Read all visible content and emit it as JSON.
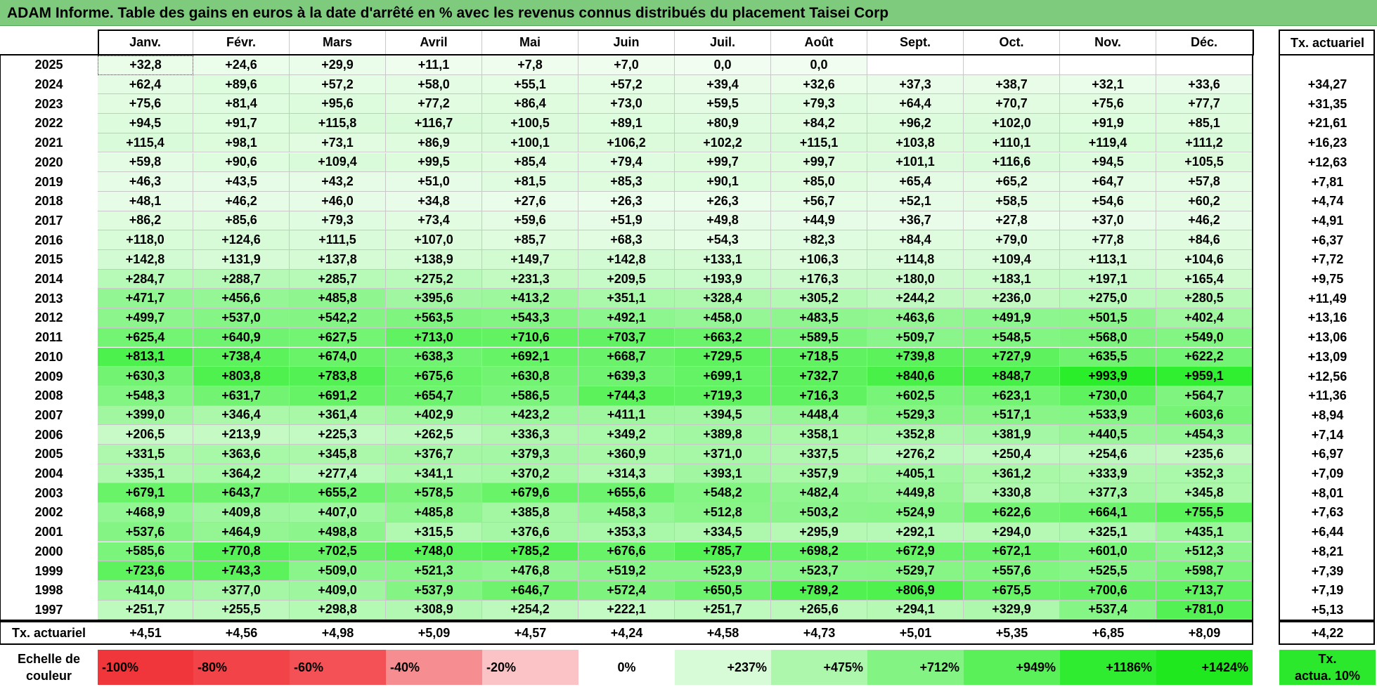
{
  "title": "ADAM Informe. Table des gains en euros à la date d'arrêté en % avec les revenus connus distribués du placement Taisei Corp",
  "months": [
    "Janv.",
    "Févr.",
    "Mars",
    "Avril",
    "Mai",
    "Juin",
    "Juil.",
    "Août",
    "Sept.",
    "Oct.",
    "Nov.",
    "Déc."
  ],
  "rate_header": "Tx. actuariel",
  "rows": [
    {
      "year": "2025",
      "values": [
        "+32,8",
        "+24,6",
        "+29,9",
        "+11,1",
        "+7,8",
        "+7,0",
        "0,0",
        "0,0",
        "",
        "",
        "",
        ""
      ],
      "rate": ""
    },
    {
      "year": "2024",
      "values": [
        "+62,4",
        "+89,6",
        "+57,2",
        "+58,0",
        "+55,1",
        "+57,2",
        "+39,4",
        "+32,6",
        "+37,3",
        "+38,7",
        "+32,1",
        "+33,6"
      ],
      "rate": "+34,27"
    },
    {
      "year": "2023",
      "values": [
        "+75,6",
        "+81,4",
        "+95,6",
        "+77,2",
        "+86,4",
        "+73,0",
        "+59,5",
        "+79,3",
        "+64,4",
        "+70,7",
        "+75,6",
        "+77,7"
      ],
      "rate": "+31,35"
    },
    {
      "year": "2022",
      "values": [
        "+94,5",
        "+91,7",
        "+115,8",
        "+116,7",
        "+100,5",
        "+89,1",
        "+80,9",
        "+84,2",
        "+96,2",
        "+102,0",
        "+91,9",
        "+85,1"
      ],
      "rate": "+21,61"
    },
    {
      "year": "2021",
      "values": [
        "+115,4",
        "+98,1",
        "+73,1",
        "+86,9",
        "+100,1",
        "+106,2",
        "+102,2",
        "+115,1",
        "+103,8",
        "+110,1",
        "+119,4",
        "+111,2"
      ],
      "rate": "+16,23"
    },
    {
      "year": "2020",
      "values": [
        "+59,8",
        "+90,6",
        "+109,4",
        "+99,5",
        "+85,4",
        "+79,4",
        "+99,7",
        "+99,7",
        "+101,1",
        "+116,6",
        "+94,5",
        "+105,5"
      ],
      "rate": "+12,63"
    },
    {
      "year": "2019",
      "values": [
        "+46,3",
        "+43,5",
        "+43,2",
        "+51,0",
        "+81,5",
        "+85,3",
        "+90,1",
        "+85,0",
        "+65,4",
        "+65,2",
        "+64,7",
        "+57,8"
      ],
      "rate": "+7,81"
    },
    {
      "year": "2018",
      "values": [
        "+48,1",
        "+46,2",
        "+46,0",
        "+34,8",
        "+27,6",
        "+26,3",
        "+26,3",
        "+56,7",
        "+52,1",
        "+58,5",
        "+54,6",
        "+60,2"
      ],
      "rate": "+4,74"
    },
    {
      "year": "2017",
      "values": [
        "+86,2",
        "+85,6",
        "+79,3",
        "+73,4",
        "+59,6",
        "+51,9",
        "+49,8",
        "+44,9",
        "+36,7",
        "+27,8",
        "+37,0",
        "+46,2"
      ],
      "rate": "+4,91"
    },
    {
      "year": "2016",
      "values": [
        "+118,0",
        "+124,6",
        "+111,5",
        "+107,0",
        "+85,7",
        "+68,3",
        "+54,3",
        "+82,3",
        "+84,4",
        "+79,0",
        "+77,8",
        "+84,6"
      ],
      "rate": "+6,37"
    },
    {
      "year": "2015",
      "values": [
        "+142,8",
        "+131,9",
        "+137,8",
        "+138,9",
        "+149,7",
        "+142,8",
        "+133,1",
        "+106,3",
        "+114,8",
        "+109,4",
        "+113,1",
        "+104,6"
      ],
      "rate": "+7,72"
    },
    {
      "year": "2014",
      "values": [
        "+284,7",
        "+288,7",
        "+285,7",
        "+275,2",
        "+231,3",
        "+209,5",
        "+193,9",
        "+176,3",
        "+180,0",
        "+183,1",
        "+197,1",
        "+165,4"
      ],
      "rate": "+9,75"
    },
    {
      "year": "2013",
      "values": [
        "+471,7",
        "+456,6",
        "+485,8",
        "+395,6",
        "+413,2",
        "+351,1",
        "+328,4",
        "+305,2",
        "+244,2",
        "+236,0",
        "+275,0",
        "+280,5"
      ],
      "rate": "+11,49"
    },
    {
      "year": "2012",
      "values": [
        "+499,7",
        "+537,0",
        "+542,2",
        "+563,5",
        "+543,3",
        "+492,1",
        "+458,0",
        "+483,5",
        "+463,6",
        "+491,9",
        "+501,5",
        "+402,4"
      ],
      "rate": "+13,16"
    },
    {
      "year": "2011",
      "values": [
        "+625,4",
        "+640,9",
        "+627,5",
        "+713,0",
        "+710,6",
        "+703,7",
        "+663,2",
        "+589,5",
        "+509,7",
        "+548,5",
        "+568,0",
        "+549,0"
      ],
      "rate": "+13,06"
    },
    {
      "year": "2010",
      "values": [
        "+813,1",
        "+738,4",
        "+674,0",
        "+638,3",
        "+692,1",
        "+668,7",
        "+729,5",
        "+718,5",
        "+739,8",
        "+727,9",
        "+635,5",
        "+622,2"
      ],
      "rate": "+13,09"
    },
    {
      "year": "2009",
      "values": [
        "+630,3",
        "+803,8",
        "+783,8",
        "+675,6",
        "+630,8",
        "+639,3",
        "+699,1",
        "+732,7",
        "+840,6",
        "+848,7",
        "+993,9",
        "+959,1"
      ],
      "rate": "+12,56"
    },
    {
      "year": "2008",
      "values": [
        "+548,3",
        "+631,7",
        "+691,2",
        "+654,7",
        "+586,5",
        "+744,3",
        "+719,3",
        "+716,3",
        "+602,5",
        "+623,1",
        "+730,0",
        "+564,7"
      ],
      "rate": "+11,36"
    },
    {
      "year": "2007",
      "values": [
        "+399,0",
        "+346,4",
        "+361,4",
        "+402,9",
        "+423,2",
        "+411,1",
        "+394,5",
        "+448,4",
        "+529,3",
        "+517,1",
        "+533,9",
        "+603,6"
      ],
      "rate": "+8,94"
    },
    {
      "year": "2006",
      "values": [
        "+206,5",
        "+213,9",
        "+225,3",
        "+262,5",
        "+336,3",
        "+349,2",
        "+389,8",
        "+358,1",
        "+352,8",
        "+381,9",
        "+440,5",
        "+454,3"
      ],
      "rate": "+7,14"
    },
    {
      "year": "2005",
      "values": [
        "+331,5",
        "+363,6",
        "+345,8",
        "+376,7",
        "+379,3",
        "+360,9",
        "+371,0",
        "+337,5",
        "+276,2",
        "+250,4",
        "+254,6",
        "+235,6"
      ],
      "rate": "+6,97"
    },
    {
      "year": "2004",
      "values": [
        "+335,1",
        "+364,2",
        "+277,4",
        "+341,1",
        "+370,2",
        "+314,3",
        "+393,1",
        "+357,9",
        "+405,1",
        "+361,2",
        "+333,9",
        "+352,3"
      ],
      "rate": "+7,09"
    },
    {
      "year": "2003",
      "values": [
        "+679,1",
        "+643,7",
        "+655,2",
        "+578,5",
        "+679,6",
        "+655,6",
        "+548,2",
        "+482,4",
        "+449,8",
        "+330,8",
        "+377,3",
        "+345,8"
      ],
      "rate": "+8,01"
    },
    {
      "year": "2002",
      "values": [
        "+468,9",
        "+409,8",
        "+407,0",
        "+485,8",
        "+385,8",
        "+458,3",
        "+512,8",
        "+503,2",
        "+524,9",
        "+622,6",
        "+664,1",
        "+755,5"
      ],
      "rate": "+7,63"
    },
    {
      "year": "2001",
      "values": [
        "+537,6",
        "+464,9",
        "+498,8",
        "+315,5",
        "+376,6",
        "+353,3",
        "+334,5",
        "+295,9",
        "+292,1",
        "+294,0",
        "+325,1",
        "+435,1"
      ],
      "rate": "+6,44"
    },
    {
      "year": "2000",
      "values": [
        "+585,6",
        "+770,8",
        "+702,5",
        "+748,0",
        "+785,2",
        "+676,6",
        "+785,7",
        "+698,2",
        "+672,9",
        "+672,1",
        "+601,0",
        "+512,3"
      ],
      "rate": "+8,21"
    },
    {
      "year": "1999",
      "values": [
        "+723,6",
        "+743,3",
        "+509,0",
        "+521,3",
        "+476,8",
        "+519,2",
        "+523,9",
        "+523,7",
        "+529,7",
        "+557,6",
        "+525,5",
        "+598,7"
      ],
      "rate": "+7,39"
    },
    {
      "year": "1998",
      "values": [
        "+414,0",
        "+377,0",
        "+409,0",
        "+537,9",
        "+646,7",
        "+572,4",
        "+650,5",
        "+789,2",
        "+806,9",
        "+675,5",
        "+700,6",
        "+713,7"
      ],
      "rate": "+7,19"
    },
    {
      "year": "1997",
      "values": [
        "+251,7",
        "+255,5",
        "+298,8",
        "+308,9",
        "+254,2",
        "+222,1",
        "+251,7",
        "+265,6",
        "+294,1",
        "+329,9",
        "+537,4",
        "+781,0"
      ],
      "rate": "+5,13"
    }
  ],
  "summary": {
    "label": "Tx. actuariel",
    "values": [
      "+4,51",
      "+4,56",
      "+4,98",
      "+5,09",
      "+4,57",
      "+4,24",
      "+4,58",
      "+4,73",
      "+5,01",
      "+5,35",
      "+6,85",
      "+8,09"
    ],
    "rate": "+4,22"
  },
  "scale": {
    "label_line1": "Echelle de",
    "label_line2": "couleur",
    "items": [
      {
        "text": "-100%",
        "color": "#f0363b",
        "align": "left"
      },
      {
        "text": "-80%",
        "color": "#f24348",
        "align": "left"
      },
      {
        "text": "-60%",
        "color": "#f35156",
        "align": "left"
      },
      {
        "text": "-40%",
        "color": "#f68e91",
        "align": "left"
      },
      {
        "text": "-20%",
        "color": "#fbc3c5",
        "align": "left"
      },
      {
        "text": "0%",
        "color": "#ffffff",
        "align": "center"
      },
      {
        "text": "+237%",
        "color": "#d6fbd6",
        "align": "right"
      },
      {
        "text": "+475%",
        "color": "#adf7ad",
        "align": "right"
      },
      {
        "text": "+712%",
        "color": "#83f483",
        "align": "right"
      },
      {
        "text": "+949%",
        "color": "#5af05a",
        "align": "right"
      },
      {
        "text": "+1186%",
        "color": "#30ec30",
        "align": "right"
      },
      {
        "text": "+1424%",
        "color": "#1fe81f",
        "align": "right"
      }
    ],
    "rate_line1": "Tx.",
    "rate_line2": "actua. 10%",
    "rate_color": "#2ce82c"
  },
  "colors": {
    "title_bg": "#7ecb7e",
    "max_value_color": "#2ee82e"
  }
}
